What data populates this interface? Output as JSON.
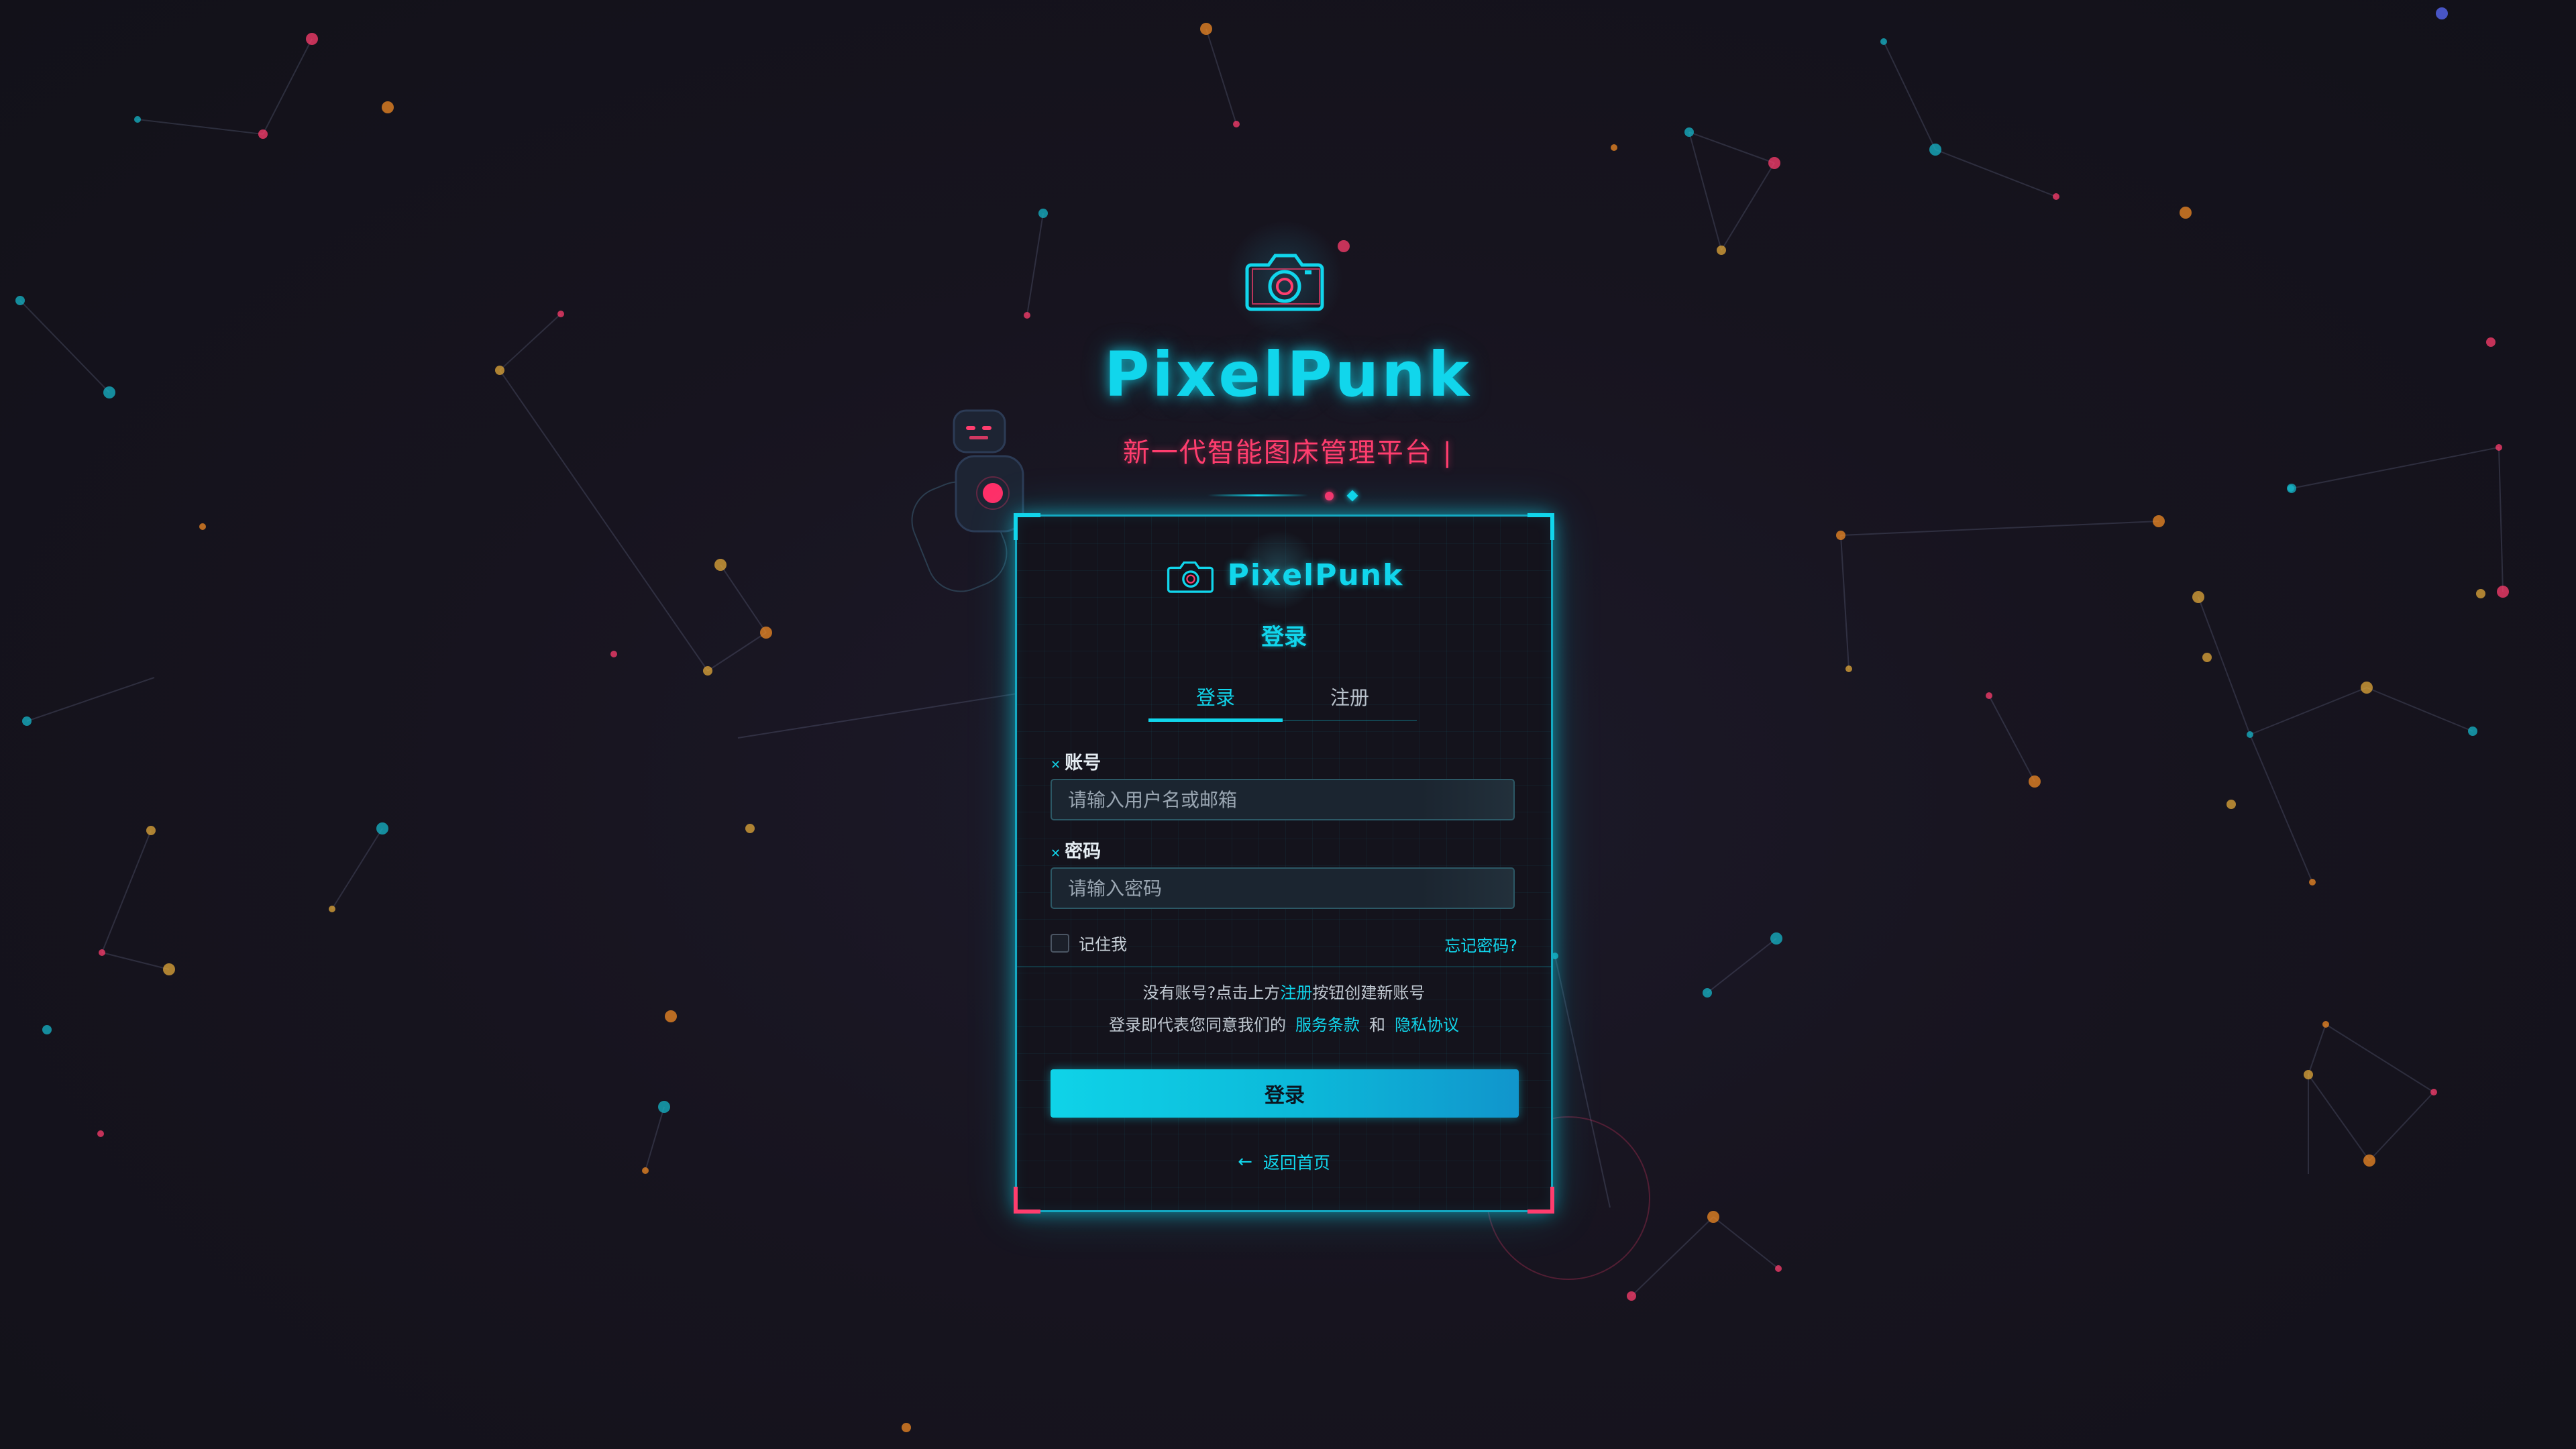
{
  "brand": {
    "name": "PixelPunk",
    "tagline": "新一代智能图床管理平台",
    "caret": "|",
    "logo_icon": "camera-icon",
    "accent_cyan": "#11d6ec",
    "accent_pink": "#ff3d6e"
  },
  "card": {
    "title": "登录",
    "tabs": [
      {
        "label": "登录",
        "active": true
      },
      {
        "label": "注册",
        "active": false
      }
    ],
    "username": {
      "label": "账号",
      "placeholder": "请输入用户名或邮箱",
      "value": ""
    },
    "password": {
      "label": "密码",
      "placeholder": "请输入密码",
      "value": ""
    },
    "remember_label": "记住我",
    "remember_checked": false,
    "forgot_label": "忘记密码?",
    "hint": {
      "prefix": "没有账号?点击上方",
      "link": "注册",
      "suffix": "按钮创建新账号"
    },
    "terms": {
      "prefix": "登录即代表您同意我们的",
      "service_link": "服务条款",
      "and": "和",
      "privacy_link": "隐私协议"
    },
    "login_button": "登录",
    "back_label": "返回首页",
    "back_arrow": "←"
  }
}
